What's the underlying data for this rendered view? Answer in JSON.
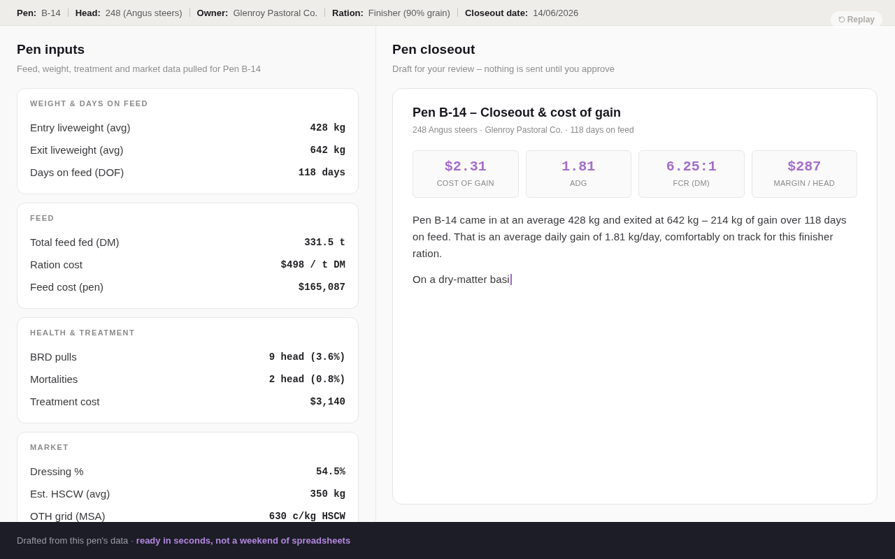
{
  "header": {
    "fields": [
      {
        "label": "Pen:",
        "value": "B-14"
      },
      {
        "label": "Head:",
        "value": "248 (Angus steers)"
      },
      {
        "label": "Owner:",
        "value": "Glenroy Pastoral Co."
      },
      {
        "label": "Ration:",
        "value": "Finisher (90% grain)"
      },
      {
        "label": "Closeout date:",
        "value": "14/06/2026"
      }
    ],
    "replay_button": "Replay"
  },
  "inputs": {
    "title": "Pen inputs",
    "subtitle": "Feed, weight, treatment and market data pulled for Pen B-14",
    "sections": [
      {
        "heading": "WEIGHT & DAYS ON FEED",
        "rows": [
          {
            "label": "Entry liveweight (avg)",
            "value": "428 kg"
          },
          {
            "label": "Exit liveweight (avg)",
            "value": "642 kg"
          },
          {
            "label": "Days on feed (DOF)",
            "value": "118 days"
          }
        ]
      },
      {
        "heading": "FEED",
        "rows": [
          {
            "label": "Total feed fed (DM)",
            "value": "331.5 t"
          },
          {
            "label": "Ration cost",
            "value": "$498 / t DM"
          },
          {
            "label": "Feed cost (pen)",
            "value": "$165,087"
          }
        ]
      },
      {
        "heading": "HEALTH & TREATMENT",
        "rows": [
          {
            "label": "BRD pulls",
            "value": "9 head (3.6%)"
          },
          {
            "label": "Mortalities",
            "value": "2 head (0.8%)"
          },
          {
            "label": "Treatment cost",
            "value": "$3,140"
          }
        ]
      },
      {
        "heading": "MARKET",
        "rows": [
          {
            "label": "Dressing %",
            "value": "54.5%"
          },
          {
            "label": "Est. HSCW (avg)",
            "value": "350 kg"
          },
          {
            "label": "OTH grid (MSA)",
            "value": "630 c/kg HSCW"
          }
        ]
      }
    ]
  },
  "closeout": {
    "title": "Pen closeout",
    "subtitle": "Draft for your review – nothing is sent until you approve",
    "document": {
      "title": "Pen B-14 – Closeout & cost of gain",
      "meta": "248 Angus steers · Glenroy Pastoral Co. · 118 days on feed",
      "metrics": [
        {
          "value": "$2.31",
          "label": "COST OF GAIN"
        },
        {
          "value": "1.81",
          "label": "ADG"
        },
        {
          "value": "6.25:1",
          "label": "FCR (DM)"
        },
        {
          "value": "$287",
          "label": "MARGIN / HEAD"
        }
      ],
      "paragraphs": [
        "Pen B-14 came in at an average 428 kg and exited at 642 kg – 214 kg of gain over 118 days on feed. That is an average daily gain of 1.81 kg/day, comfortably on track for this finisher ration.",
        "On a dry-matter basi"
      ],
      "typing": true
    }
  },
  "footer": "Drafted from this pen's data · **ready in seconds, not a weekend of spreadsheets**"
}
